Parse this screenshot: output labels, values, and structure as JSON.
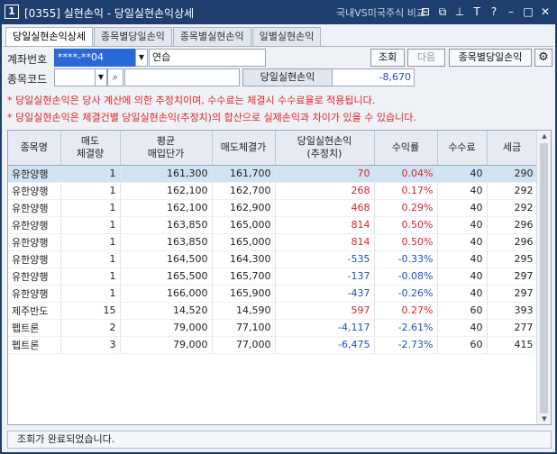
{
  "window": {
    "number": "1",
    "title": "[0355] 실현손익 - 당일실현손익상세",
    "right_caption": "국내VS미국주식 비교",
    "icons": [
      "link-icon",
      "copy-icon",
      "pin-icon",
      "font-icon",
      "help-icon",
      "minimize-icon",
      "maximize-icon",
      "close-icon"
    ]
  },
  "tabs": [
    "당일실현손익상세",
    "종목별당일손익",
    "종목별실현손익",
    "일별실현손익"
  ],
  "form": {
    "account_label": "계좌번호",
    "account_value": "****-**04",
    "account_name": "연습",
    "query_button": "조회",
    "next_button": "다음",
    "by_stock_button": "종목별당일손익",
    "code_label": "종목코드",
    "realized_label": "당일실현손익",
    "realized_value": "-8,670"
  },
  "notices": [
    "* 당일실현손익은 당사 계산에 의한 추정치이며, 수수료는 체결시 수수료율로 적용됩니다.",
    "* 당일실현손익은 체결건별 당일실현손익(추정치)의 합산으로 실제손익과 차이가 있을 수 있습니다."
  ],
  "table": {
    "headers": [
      [
        "종목명",
        ""
      ],
      [
        "매도",
        "체결량"
      ],
      [
        "평균",
        "매입단가"
      ],
      [
        "매도체결가",
        ""
      ],
      [
        "당일실현손익",
        "(추정치)"
      ],
      [
        "수익률",
        ""
      ],
      [
        "수수료",
        ""
      ],
      [
        "세금",
        ""
      ]
    ],
    "rows": [
      {
        "name": "유한양행",
        "qty": "1",
        "avg": "161,300",
        "sell": "161,700",
        "pnl": "70",
        "rate": "0.04%",
        "fee": "40",
        "tax": "290",
        "sign": "pos"
      },
      {
        "name": "유한양행",
        "qty": "1",
        "avg": "162,100",
        "sell": "162,700",
        "pnl": "268",
        "rate": "0.17%",
        "fee": "40",
        "tax": "292",
        "sign": "pos"
      },
      {
        "name": "유한양행",
        "qty": "1",
        "avg": "162,100",
        "sell": "162,900",
        "pnl": "468",
        "rate": "0.29%",
        "fee": "40",
        "tax": "292",
        "sign": "pos"
      },
      {
        "name": "유한양행",
        "qty": "1",
        "avg": "163,850",
        "sell": "165,000",
        "pnl": "814",
        "rate": "0.50%",
        "fee": "40",
        "tax": "296",
        "sign": "pos"
      },
      {
        "name": "유한양행",
        "qty": "1",
        "avg": "163,850",
        "sell": "165,000",
        "pnl": "814",
        "rate": "0.50%",
        "fee": "40",
        "tax": "296",
        "sign": "pos"
      },
      {
        "name": "유한양행",
        "qty": "1",
        "avg": "164,500",
        "sell": "164,300",
        "pnl": "-535",
        "rate": "-0.33%",
        "fee": "40",
        "tax": "295",
        "sign": "neg"
      },
      {
        "name": "유한양행",
        "qty": "1",
        "avg": "165,500",
        "sell": "165,700",
        "pnl": "-137",
        "rate": "-0.08%",
        "fee": "40",
        "tax": "297",
        "sign": "neg"
      },
      {
        "name": "유한양행",
        "qty": "1",
        "avg": "166,000",
        "sell": "165,900",
        "pnl": "-437",
        "rate": "-0.26%",
        "fee": "40",
        "tax": "297",
        "sign": "neg"
      },
      {
        "name": "제주반도",
        "qty": "15",
        "avg": "14,520",
        "sell": "14,590",
        "pnl": "597",
        "rate": "0.27%",
        "fee": "60",
        "tax": "393",
        "sign": "pos"
      },
      {
        "name": "펩트론",
        "qty": "2",
        "avg": "79,000",
        "sell": "77,100",
        "pnl": "-4,117",
        "rate": "-2.61%",
        "fee": "40",
        "tax": "277",
        "sign": "neg"
      },
      {
        "name": "펩트론",
        "qty": "3",
        "avg": "79,000",
        "sell": "77,000",
        "pnl": "-6,475",
        "rate": "-2.73%",
        "fee": "60",
        "tax": "415",
        "sign": "neg"
      }
    ]
  },
  "status": "조회가 완료되었습니다.",
  "colors": {
    "positive": "#d8232a",
    "negative": "#1f4fc2",
    "title_bg": "#1e3e6e",
    "selected_row": "#cfe3f2"
  }
}
